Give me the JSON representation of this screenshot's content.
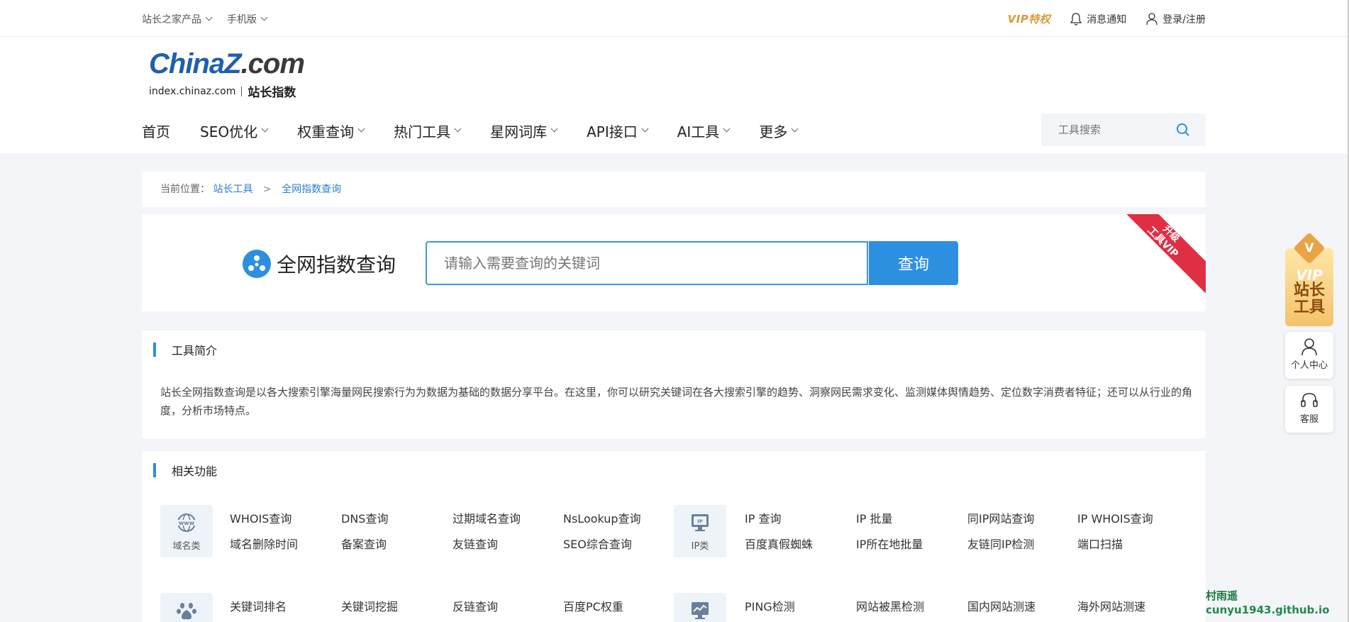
{
  "topbar": {
    "left_items": [
      "站长之家产品",
      "手机版"
    ],
    "vip_label": "VIP特权",
    "notify_label": "消息通知",
    "login_label": "登录/注册"
  },
  "logo": {
    "brand_pre": "China",
    "brand_z": "Z",
    "brand_post": ".com",
    "domain": "index.chinaz.com",
    "product": "站长指数"
  },
  "nav": {
    "items": [
      {
        "label": "首页",
        "has_dropdown": false
      },
      {
        "label": "SEO优化",
        "has_dropdown": true
      },
      {
        "label": "权重查询",
        "has_dropdown": true
      },
      {
        "label": "热门工具",
        "has_dropdown": true
      },
      {
        "label": "星网词库",
        "has_dropdown": true
      },
      {
        "label": "API接口",
        "has_dropdown": true
      },
      {
        "label": "AI工具",
        "has_dropdown": true
      },
      {
        "label": "更多",
        "has_dropdown": true
      }
    ],
    "search_placeholder": "工具搜索"
  },
  "breadcrumb": {
    "prefix": "当前位置：",
    "link1": "站长工具",
    "separator": ">",
    "link2": "全网指数查询"
  },
  "query": {
    "title": "全网指数查询",
    "placeholder": "请输入需要查询的关键词",
    "button": "查询",
    "ribbon_line1": "升级",
    "ribbon_line2": "工具VIP"
  },
  "intro": {
    "title": "工具简介",
    "text": "站长全网指数查询是以各大搜索引擎海量网民搜索行为为数据为基础的数据分享平台。在这里，你可以研究关键词在各大搜索引擎的趋势、洞察网民需求变化、监测媒体舆情趋势、定位数字消费者特征；还可以从行业的角度，分析市场特点。"
  },
  "related": {
    "title": "相关功能",
    "categories": [
      {
        "label": "域名类",
        "icon": "www-globe-icon"
      },
      {
        "label": "IP类",
        "icon": "ip-monitor-icon"
      }
    ],
    "domain_links": [
      "WHOIS查询",
      "DNS查询",
      "过期域名查询",
      "NsLookup查询",
      "域名删除时间",
      "备案查询",
      "友链查询",
      "SEO综合查询"
    ],
    "ip_links": [
      "IP 查询",
      "IP 批量",
      "同IP网站查询",
      "IP WHOIS查询",
      "百度真假蜘蛛",
      "IP所在地批量",
      "友链同IP检测",
      "端口扫描"
    ],
    "row3_left": [
      "关键词排名",
      "关键词挖掘",
      "反链查询",
      "百度PC权重"
    ],
    "row3_right": [
      "PING检测",
      "网站被黑检测",
      "国内网站测速",
      "海外网站测速"
    ]
  },
  "sidebar": {
    "vip_small": "VIP",
    "vip_text": "站长工具",
    "vip_gem": "V",
    "personal_center": "个人中心",
    "service": "客服"
  },
  "watermark": {
    "line1": "村雨遥",
    "line2": "cunyu1943.github.io"
  }
}
